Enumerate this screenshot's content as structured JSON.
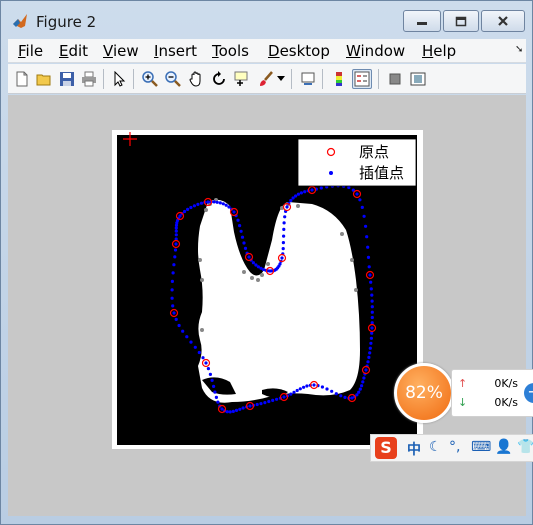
{
  "window": {
    "title": "Figure 2",
    "minimize_label": "minimize",
    "maximize_label": "maximize",
    "close_label": "close"
  },
  "menubar": {
    "items": [
      {
        "label": "File",
        "mnemonic": "F",
        "rest": "ile"
      },
      {
        "label": "Edit",
        "mnemonic": "E",
        "rest": "dit"
      },
      {
        "label": "View",
        "mnemonic": "V",
        "rest": "iew"
      },
      {
        "label": "Insert",
        "mnemonic": "I",
        "rest": "nsert"
      },
      {
        "label": "Tools",
        "mnemonic": "T",
        "rest": "ools"
      },
      {
        "label": "Desktop",
        "mnemonic": "D",
        "rest": "esktop"
      },
      {
        "label": "Window",
        "mnemonic": "W",
        "rest": "indow"
      },
      {
        "label": "Help",
        "mnemonic": "H",
        "rest": "elp"
      }
    ],
    "overflow_arrow": "➘"
  },
  "toolbar": {
    "buttons": [
      "new-figure-icon",
      "open-file-icon",
      "save-icon",
      "print-icon",
      "edit-plot-arrow-icon",
      "zoom-in-icon",
      "zoom-out-icon",
      "pan-hand-icon",
      "rotate-3d-icon",
      "data-cursor-icon",
      "brush-icon",
      "link-plot-icon",
      "insert-colorbar-icon",
      "insert-legend-icon",
      "hide-plot-tools-icon",
      "show-plot-tools-icon"
    ]
  },
  "plot": {
    "legend": {
      "original_label": "原点",
      "interp_label": "插值点",
      "original_color": "#ff0000",
      "interp_color": "#0000ff"
    }
  },
  "overlay": {
    "percent": "82%",
    "upload_speed": "0K/s",
    "download_speed": "0K/s",
    "plus": "+"
  },
  "ime": {
    "logo": "S",
    "mode": "中",
    "items": [
      "moon-icon",
      "punctuation-icon",
      "keyboard-icon",
      "user-icon",
      "shirt-icon"
    ]
  }
}
